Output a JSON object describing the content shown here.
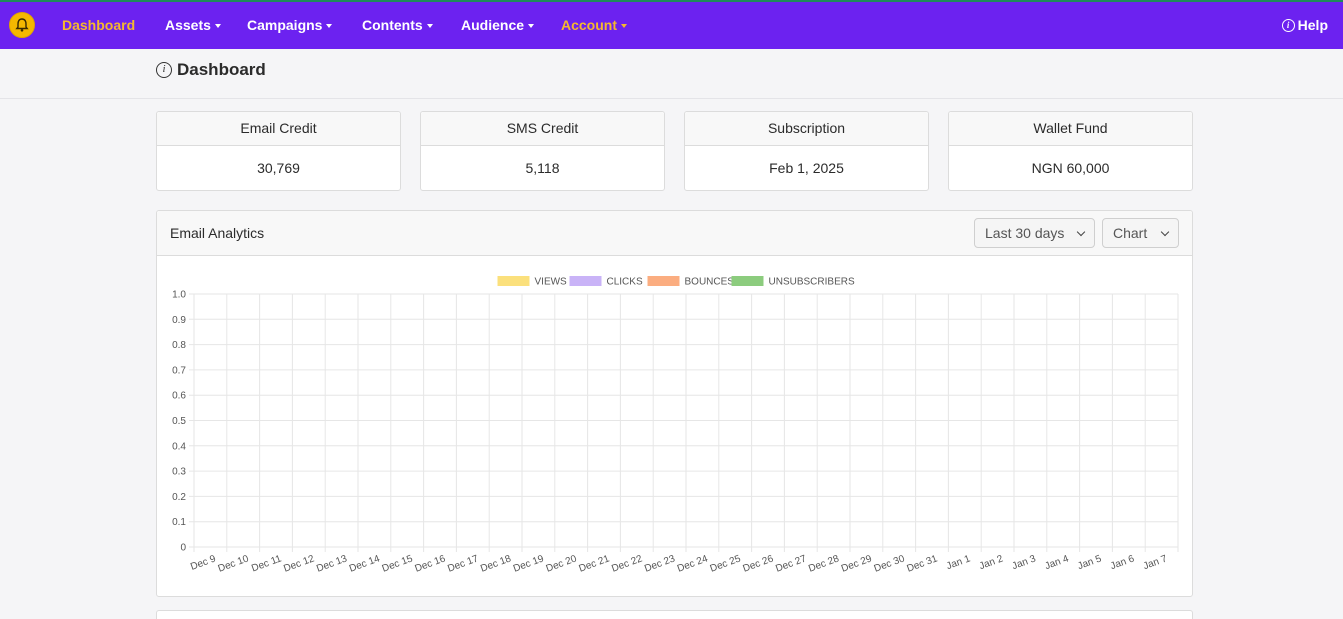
{
  "nav": {
    "items": [
      {
        "label": "Dashboard",
        "active": true,
        "caret": false
      },
      {
        "label": "Assets",
        "active": false,
        "caret": true
      },
      {
        "label": "Campaigns",
        "active": false,
        "caret": true
      },
      {
        "label": "Contents",
        "active": false,
        "caret": true
      },
      {
        "label": "Audience",
        "active": false,
        "caret": true
      },
      {
        "label": "Account",
        "active": true,
        "caret": true
      }
    ],
    "help_label": "Help",
    "logo_icon": "bell-icon"
  },
  "page": {
    "title": "Dashboard"
  },
  "cards": [
    {
      "label": "Email Credit",
      "value": "30,769"
    },
    {
      "label": "SMS Credit",
      "value": "5,118"
    },
    {
      "label": "Subscription",
      "value": "Feb 1, 2025"
    },
    {
      "label": "Wallet Fund",
      "value": "NGN 60,000"
    }
  ],
  "analytics": {
    "title": "Email Analytics",
    "range_select": "Last 30 days",
    "view_select": "Chart"
  },
  "colors": {
    "nav_bg": "#6c22f0",
    "accent": "#f5b82e"
  },
  "chart_data": {
    "type": "bar",
    "categories": [
      "Dec 9",
      "Dec 10",
      "Dec 11",
      "Dec 12",
      "Dec 13",
      "Dec 14",
      "Dec 15",
      "Dec 16",
      "Dec 17",
      "Dec 18",
      "Dec 19",
      "Dec 20",
      "Dec 21",
      "Dec 22",
      "Dec 23",
      "Dec 24",
      "Dec 25",
      "Dec 26",
      "Dec 27",
      "Dec 28",
      "Dec 29",
      "Dec 30",
      "Dec 31",
      "Jan 1",
      "Jan 2",
      "Jan 3",
      "Jan 4",
      "Jan 5",
      "Jan 6",
      "Jan 7"
    ],
    "series": [
      {
        "name": "VIEWS",
        "color": "#fbe07c",
        "values": [
          0,
          0,
          0,
          0,
          0,
          0,
          0,
          0,
          0,
          0,
          0,
          0,
          0,
          0,
          0,
          0,
          0,
          0,
          0,
          0,
          0,
          0,
          0,
          0,
          0,
          0,
          0,
          0,
          0,
          0
        ]
      },
      {
        "name": "CLICKS",
        "color": "#c9b3f7",
        "values": [
          0,
          0,
          0,
          0,
          0,
          0,
          0,
          0,
          0,
          0,
          0,
          0,
          0,
          0,
          0,
          0,
          0,
          0,
          0,
          0,
          0,
          0,
          0,
          0,
          0,
          0,
          0,
          0,
          0,
          0
        ]
      },
      {
        "name": "BOUNCES",
        "color": "#fbad80",
        "values": [
          0,
          0,
          0,
          0,
          0,
          0,
          0,
          0,
          0,
          0,
          0,
          0,
          0,
          0,
          0,
          0,
          0,
          0,
          0,
          0,
          0,
          0,
          0,
          0,
          0,
          0,
          0,
          0,
          0,
          0
        ]
      },
      {
        "name": "UNSUBSCRIBERS",
        "color": "#8ccc7e",
        "values": [
          0,
          0,
          0,
          0,
          0,
          0,
          0,
          0,
          0,
          0,
          0,
          0,
          0,
          0,
          0,
          0,
          0,
          0,
          0,
          0,
          0,
          0,
          0,
          0,
          0,
          0,
          0,
          0,
          0,
          0
        ]
      }
    ],
    "yticks": [
      "1.0",
      "0.9",
      "0.8",
      "0.7",
      "0.6",
      "0.5",
      "0.4",
      "0.3",
      "0.2",
      "0.1",
      "0"
    ],
    "ylim": [
      0,
      1
    ],
    "grid": true,
    "legend_position": "top"
  }
}
